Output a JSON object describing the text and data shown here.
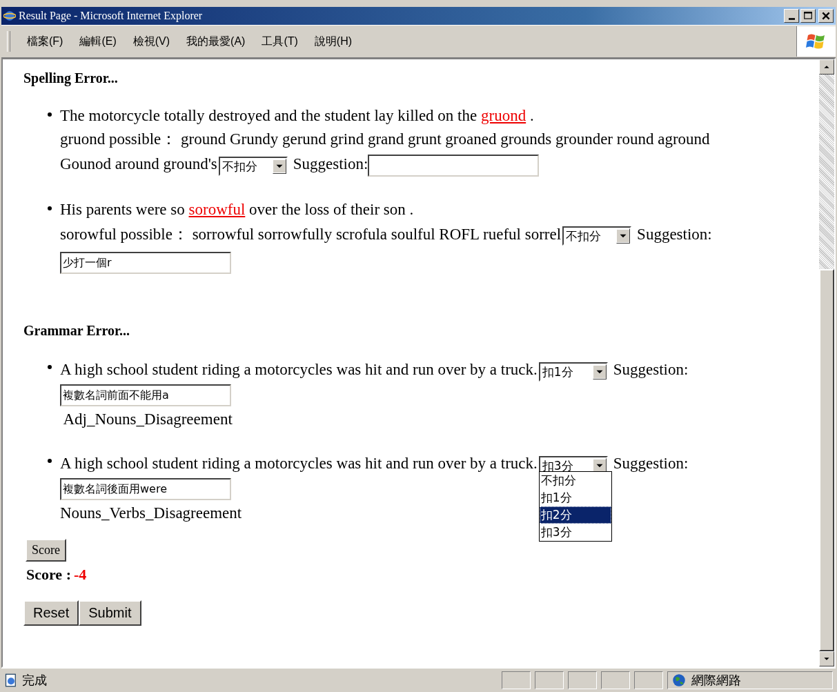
{
  "window": {
    "title": "Result Page - Microsoft Internet Explorer"
  },
  "menu": [
    "檔案(F)",
    "編輯(E)",
    "檢視(V)",
    "我的最愛(A)",
    "工具(T)",
    "說明(H)"
  ],
  "spelling": {
    "title": "Spelling Error...",
    "items": [
      {
        "before": "The motorcycle totally destroyed and the student lay killed on the",
        "word": "gruond",
        "after": ".",
        "possible": [
          "gruond possible： ground Grundy gerund grind grand grunt groaned grounds grounder round aground",
          "Gounod around ground's"
        ],
        "deduction": "不扣分",
        "suggestion_label": "Suggestion:"
      },
      {
        "before": "His parents were so",
        "word": "sorowful",
        "after": "over the loss of their son .",
        "possible": [
          "sorowful possible： sorrowful sorrowfully scrofula soulful ROFL rueful sorrel"
        ],
        "deduction": "不扣分",
        "suggestion_label": "Suggestion:",
        "suggestion": "少打一個r"
      }
    ]
  },
  "grammar": {
    "title": "Grammar Error...",
    "items": [
      {
        "sentence": "A high school student riding a motorcycles was hit and run over by a truck.",
        "deduction": "扣1分",
        "suggestion_label": "Suggestion:",
        "suggestion": "複數名詞前面不能用a",
        "error_type": " Adj_Nouns_Disagreement"
      },
      {
        "sentence": "A high school student riding a motorcycles was hit and run over by a truck.",
        "deduction": "扣3分",
        "suggestion_label": "Suggestion:",
        "suggestion": "複數名詞後面用were",
        "error_type": "Nouns_Verbs_Disagreement",
        "dropdown": [
          {
            "label": "不扣分",
            "selected": false
          },
          {
            "label": "扣1分",
            "selected": false
          },
          {
            "label": "扣2分",
            "selected": true
          },
          {
            "label": "扣3分",
            "selected": false
          }
        ]
      }
    ]
  },
  "score_button": "Score",
  "score": {
    "label": "Score :",
    "value": "-4"
  },
  "buttons": [
    "Reset",
    "Submit"
  ],
  "status": {
    "text": "完成",
    "zone": "網際網路"
  }
}
